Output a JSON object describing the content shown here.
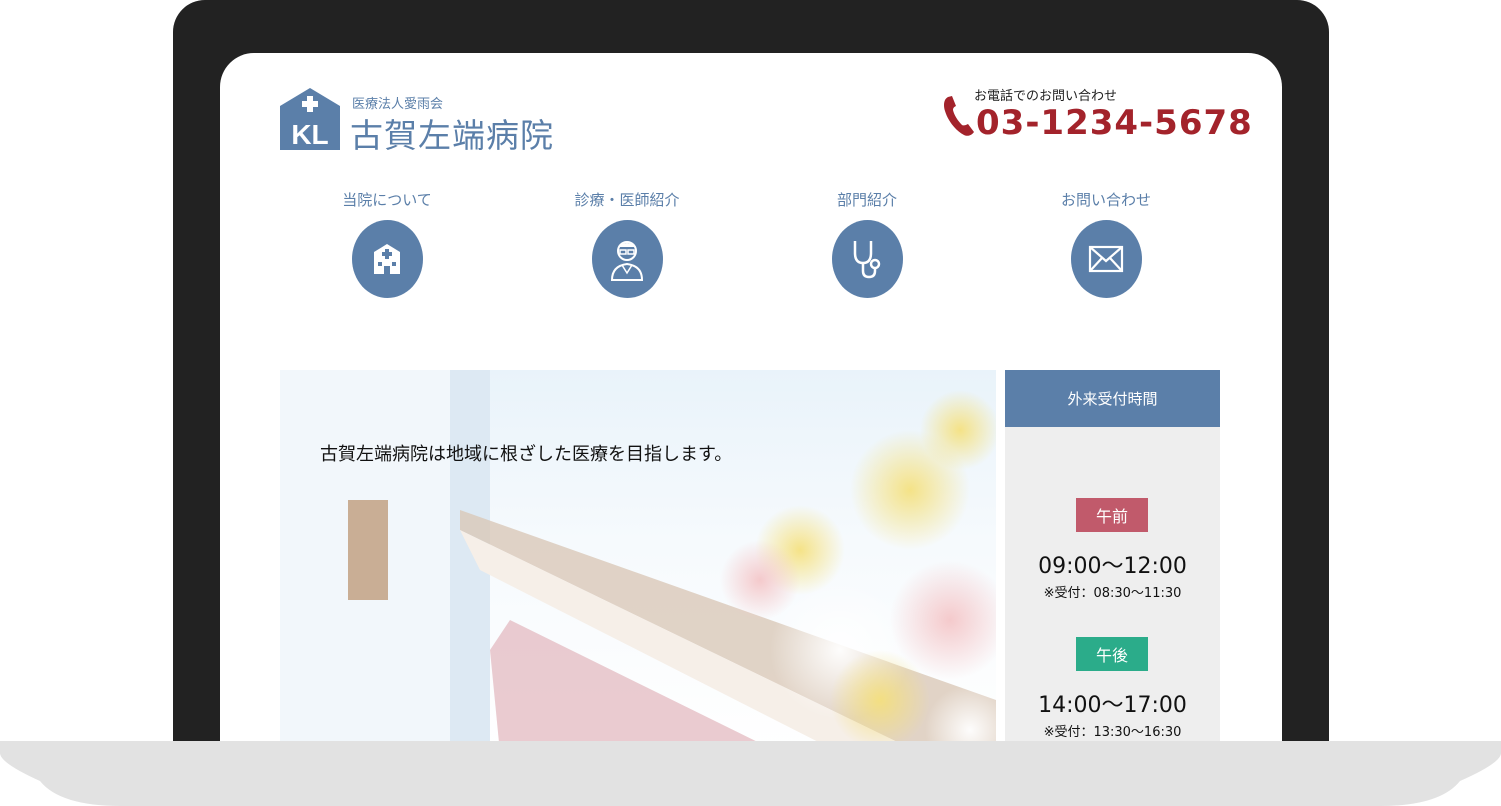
{
  "header": {
    "logo_text": "KL",
    "org_name": "医療法人愛雨会",
    "hospital_name": "古賀左端病院",
    "phone_label": "お電話でのお問い合わせ",
    "phone_number": "03-1234-5678",
    "phone_icon": "phone-icon"
  },
  "nav": {
    "items": [
      {
        "label": "当院について",
        "icon": "hospital-building-icon"
      },
      {
        "label": "診療・医師紹介",
        "icon": "doctor-icon"
      },
      {
        "label": "部門紹介",
        "icon": "stethoscope-icon"
      },
      {
        "label": "お問い合わせ",
        "icon": "envelope-icon"
      }
    ]
  },
  "hero": {
    "tagline": "古賀左端病院は地域に根ざした医療を目指します。"
  },
  "hours": {
    "title": "外来受付時間",
    "morning": {
      "label": "午前",
      "time": "09:00〜12:00",
      "reception": "※受付：08:30〜11:30",
      "color": "#c15a6b"
    },
    "afternoon": {
      "label": "午後",
      "time": "14:00〜17:00",
      "reception": "※受付：13:30〜16:30",
      "color": "#2bac8a"
    }
  },
  "colors": {
    "accent_blue": "#5b7fa9",
    "phone_red": "#a3232b",
    "laptop_bezel": "#222222",
    "laptop_base": "#e2e2e2"
  }
}
